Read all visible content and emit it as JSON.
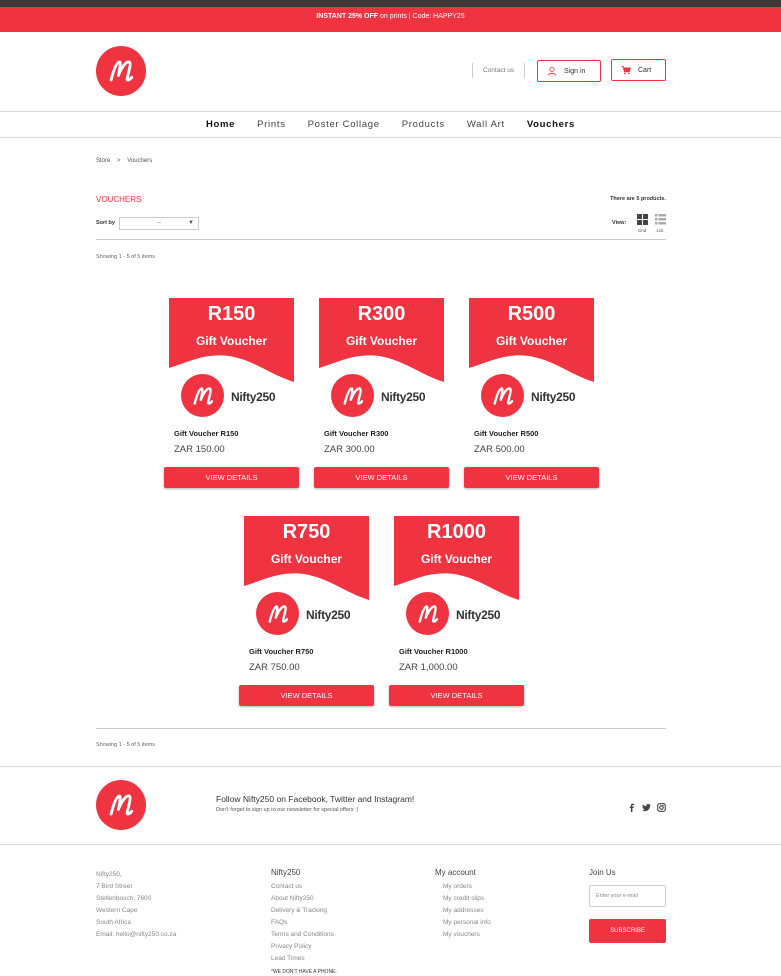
{
  "promo": {
    "highlight": "INSTANT 25% OFF",
    "rest": "on prints | Code: HAPPY25"
  },
  "header": {
    "contact": "Contact us",
    "signin": "Sign in",
    "cart": "Cart"
  },
  "nav": [
    "Home",
    "Prints",
    "Poster Collage",
    "Products",
    "Wall Art",
    "Vouchers"
  ],
  "breadcrumb": [
    "Store",
    ">",
    "Vouchers"
  ],
  "category": {
    "title": "VOUCHERS",
    "count": "There are 5 products.",
    "sort_label": "Sort by",
    "sort_value": "--",
    "view_label": "View:",
    "view_grid": "Grid",
    "view_list": "List",
    "showing": "Showing 1 - 5 of 5 items"
  },
  "voucher_art": {
    "gift_text": "Gift Voucher",
    "brand": "Nifty250"
  },
  "products": [
    {
      "amount": "R150",
      "name": "Gift Voucher R150",
      "price": "ZAR 150.00",
      "button": "VIEW DETAILS"
    },
    {
      "amount": "R300",
      "name": "Gift Voucher R300",
      "price": "ZAR 300.00",
      "button": "VIEW DETAILS"
    },
    {
      "amount": "R500",
      "name": "Gift Voucher R500",
      "price": "ZAR 500.00",
      "button": "VIEW DETAILS"
    },
    {
      "amount": "R750",
      "name": "Gift Voucher R750",
      "price": "ZAR 750.00",
      "button": "VIEW DETAILS"
    },
    {
      "amount": "R1000",
      "name": "Gift Voucher R1000",
      "price": "ZAR 1,000.00",
      "button": "VIEW DETAILS"
    }
  ],
  "footer": {
    "follow": "Follow Nifty250 on Facebook, Twitter and Instagram!",
    "follow_sub": "Don't forget to sign up to our newsletter for special offers :)",
    "social_icons": [
      "facebook-icon",
      "twitter-icon",
      "instagram-icon"
    ],
    "address": [
      "Nifty250,",
      "7 Bird Street",
      "Stellenbosch, 7600",
      "Western Cape",
      "South Africa",
      "Email: hello@nifty250.co.za"
    ],
    "col2_title": "Nifty250",
    "col2_items": [
      "Contact us",
      "About Nifty250",
      "Delivery & Tracking",
      "FAQs",
      "Terms and Conditions",
      "Privacy Policy",
      "Lead Times"
    ],
    "col3_title": "My account",
    "col3_items": [
      "My orders",
      "My credit slips",
      "My addresses",
      "My personal info",
      "My vouchers"
    ],
    "col4_title": "Join Us",
    "email_placeholder": "Enter your e-mail",
    "subscribe": "SUBSCRIBE",
    "note": "*WE DON'T HAVE A PHONE."
  },
  "colors": {
    "brand_red": "#ef3340",
    "top_strip": "#3a3a3a"
  }
}
